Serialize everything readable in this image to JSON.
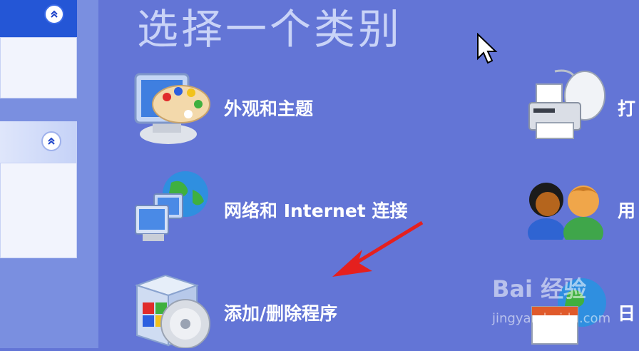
{
  "title": "选择一个类别",
  "categories": [
    {
      "label": "外观和主题",
      "icon": "monitor-paint-palette-icon"
    },
    {
      "label": "网络和 Internet 连接",
      "icon": "network-globe-icon"
    },
    {
      "label": "添加/删除程序",
      "icon": "software-box-cd-icon"
    },
    {
      "label": "打",
      "icon": "printer-mouse-icon"
    },
    {
      "label": "用",
      "icon": "users-icon"
    },
    {
      "label": "日",
      "icon": "globe-calendar-icon"
    }
  ],
  "sidebar": {
    "panel1_toggle": "collapse-up-icon",
    "panel2_toggle": "collapse-up-icon"
  },
  "watermark": {
    "brand": "Bai 经验",
    "url": "jingyan.baidu.com"
  },
  "colors": {
    "background": "#6375d6",
    "sidebar": "#7a8fe0",
    "panel_header": "#2456d6",
    "arrow": "#e5201e"
  }
}
